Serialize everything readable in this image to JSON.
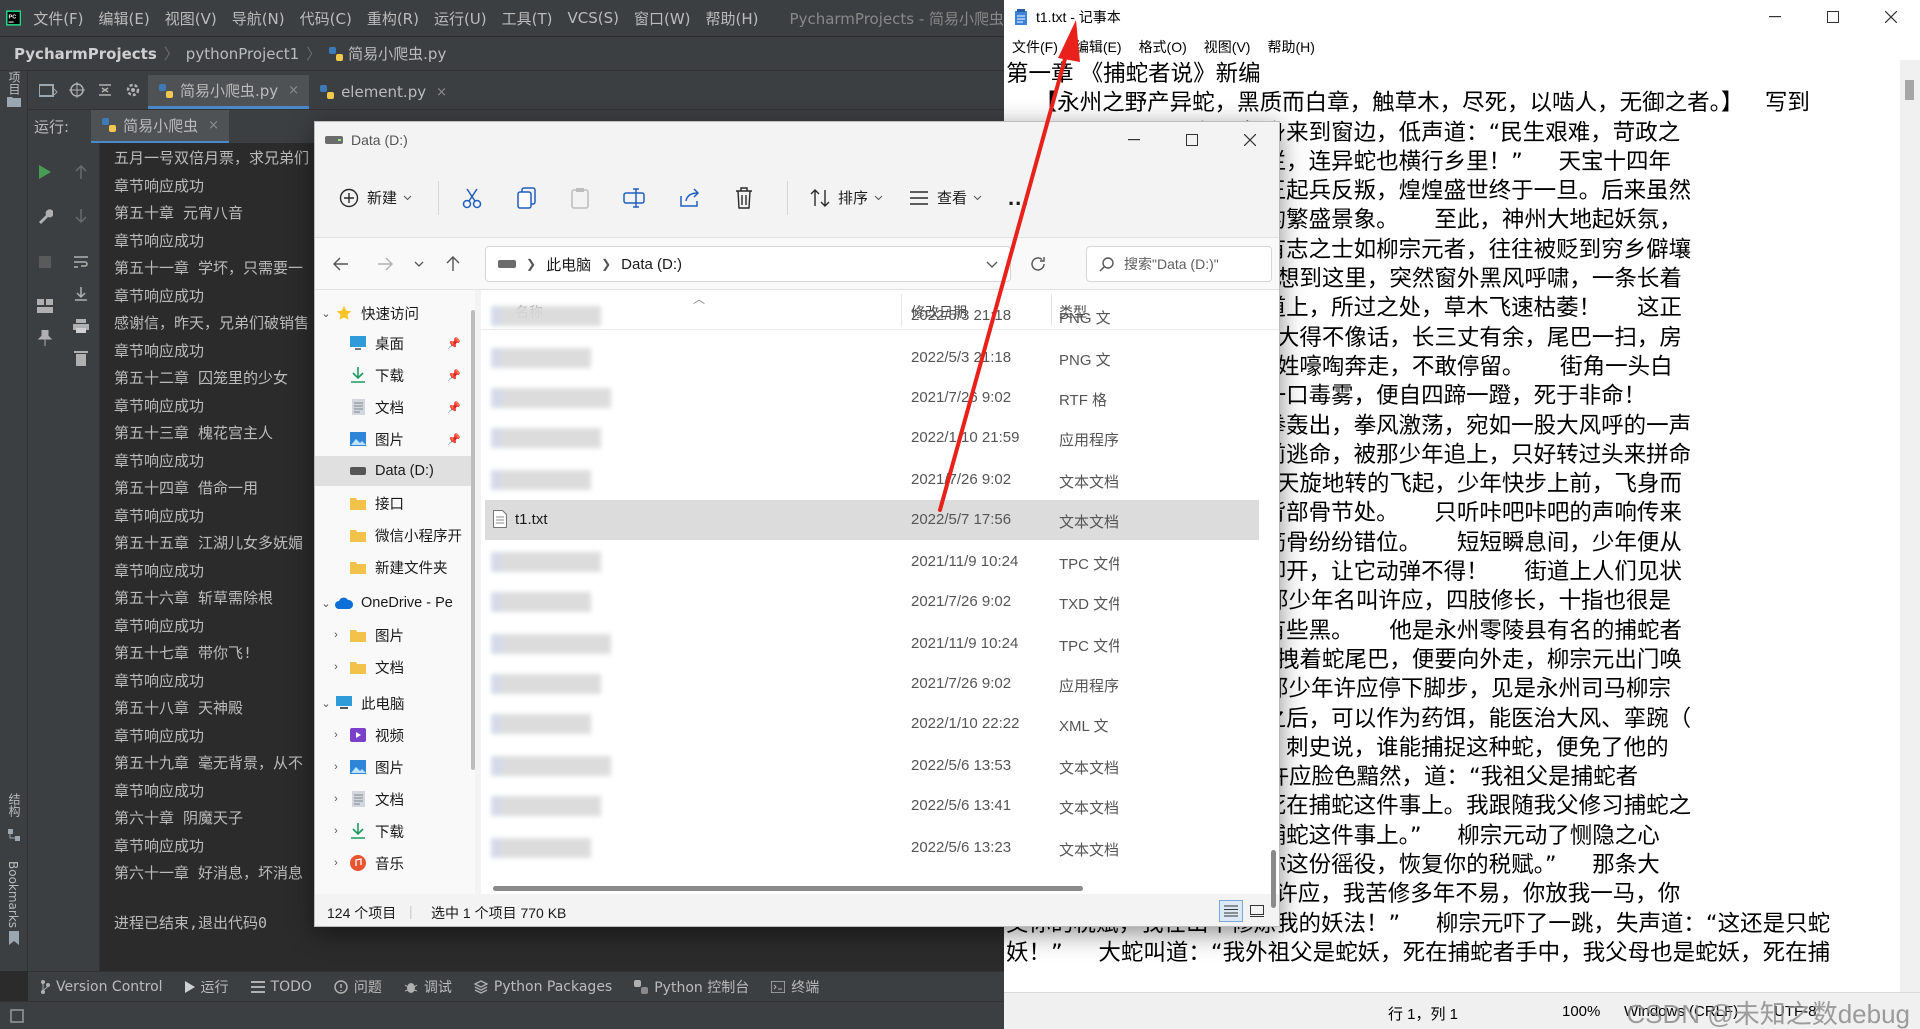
{
  "pycharm": {
    "menus": [
      "文件(F)",
      "编辑(E)",
      "视图(V)",
      "导航(N)",
      "代码(C)",
      "重构(R)",
      "运行(U)",
      "工具(T)",
      "VCS(S)",
      "窗口(W)",
      "帮助(H)"
    ],
    "title": "PycharmProjects - 简易小爬虫",
    "breadcrumb": [
      "PycharmProjects",
      "pythonProject1",
      "简易小爬虫.py"
    ],
    "left_labels": {
      "project": "项目",
      "structure": "结构",
      "bookmarks": "Bookmarks"
    },
    "editor_tabs": [
      {
        "label": "简易小爬虫.py",
        "close": "×"
      },
      {
        "label": "element.py",
        "close": "×"
      }
    ],
    "run_label": "运行:",
    "run_tab": "简易小爬虫",
    "run_tab_close": "×",
    "console_lines": [
      "五月一号双倍月票，求兄弟们",
      "章节响应成功",
      "第五十章 元宵八音",
      "章节响应成功",
      "第五十一章 学坏，只需要一",
      "章节响应成功",
      "感谢信，昨天，兄弟们破销售",
      "章节响应成功",
      "第五十二章 囚笼里的少女",
      "章节响应成功",
      "第五十三章 槐花宫主人",
      "章节响应成功",
      "第五十四章 借命一用",
      "章节响应成功",
      "第五十五章 江湖儿女多妩媚",
      "章节响应成功",
      "第五十六章 斩草需除根",
      "章节响应成功",
      "第五十七章 带你飞!",
      "章节响应成功",
      "第五十八章 天神殿",
      "章节响应成功",
      "第五十九章 毫无背景，从不",
      "章节响应成功",
      "第六十章 阴魔天子",
      "章节响应成功",
      "第六十一章 好消息，坏消息"
    ],
    "exit_line": "进程已结束,退出代码0",
    "bottom_tabs": [
      "Version Control",
      "运行",
      "TODO",
      "问题",
      "调试",
      "Python Packages",
      "Python 控制台",
      "终端"
    ]
  },
  "explorer": {
    "title": "Data (D:)",
    "toolbar": {
      "new": "新建",
      "sort": "排序",
      "view": "查看",
      "more": "..."
    },
    "address": [
      "此电脑",
      "Data (D:)"
    ],
    "search_placeholder": "搜索\"Data (D:)\"",
    "columns": {
      "name": "名称",
      "date": "修改日期",
      "type": "类型"
    },
    "nav": {
      "quick_access": "快速访问",
      "desktop": "桌面",
      "downloads": "下载",
      "documents": "文档",
      "pictures": "图片",
      "data": "Data (D:)",
      "interface": "接口",
      "wechat": "微信小程序开",
      "new_folder": "新建文件夹",
      "onedrive": "OneDrive - Pe",
      "od_pictures": "图片",
      "od_docs": "文档",
      "this_pc": "此电脑",
      "video": "视频",
      "pc_pictures": "图片",
      "pc_docs": "文档",
      "pc_downloads": "下载",
      "music": "音乐"
    },
    "files": [
      {
        "name": "",
        "date": "2022/5/3 21:18",
        "type": "PNG 文"
      },
      {
        "name": "",
        "date": "2022/5/3 21:18",
        "type": "PNG 文"
      },
      {
        "name": "",
        "date": "2021/7/26 9:02",
        "type": "RTF 格"
      },
      {
        "name": "",
        "date": "2022/1/10 21:59",
        "type": "应用程序"
      },
      {
        "name": "",
        "date": "2021/7/26 9:02",
        "type": "文本文档"
      },
      {
        "name": "t1.txt",
        "date": "2022/5/7 17:56",
        "type": "文本文档"
      },
      {
        "name": "",
        "date": "2021/11/9 10:24",
        "type": "TPC 文件"
      },
      {
        "name": "",
        "date": "2021/7/26 9:02",
        "type": "TXD 文件"
      },
      {
        "name": "",
        "date": "2021/11/9 10:24",
        "type": "TPC 文件"
      },
      {
        "name": "",
        "date": "2021/7/26 9:02",
        "type": "应用程序"
      },
      {
        "name": "",
        "date": "2022/1/10 22:22",
        "type": "XML 文"
      },
      {
        "name": "",
        "date": "2022/5/6 13:53",
        "type": "文本文档"
      },
      {
        "name": "",
        "date": "2022/5/6 13:41",
        "type": "文本文档"
      },
      {
        "name": "",
        "date": "2022/5/6 13:23",
        "type": "文本文档"
      }
    ],
    "status": {
      "count": "124 个项目",
      "selected": "选中 1 个项目  770 KB"
    }
  },
  "notepad": {
    "title": "t1.txt - 记事本",
    "menus": [
      "文件(F)",
      "编辑(E)",
      "格式(O)",
      "视图(V)",
      "帮助(H)"
    ],
    "lines": [
      "第一章 《捕蛇者说》新编",
      "    【永州之野产异蛇，黑质而白章，触草木，尽死，以啮人，无御之者。】   写到",
      "              ，叹了口气，起身来到窗边，低声道：“民生艰难，苛政之",
      "              年至今，国事糜烂，连异蛇也横行乡里！”     天宝十四年",
      "              昏庸了，东平郡王起兵反叛，煌煌盛世终于一旦。后来虽然",
      "              据，终不复当年的繁盛景象。     至此，神州大地起妖氛，",
      "              道，宦官弄权，有志之士如柳宗元者，往往被贬到穷乡僻壤",
      "              负。     柳宗元刚想到这里，突然窗外黑风呼啸，一条长着",
      "              从水沟里冲到街道上，所过之处，草木飞速枯萎！     这正",
      "              ！     只是这条蛇大得不像话，长三丈有余，尾巴一扫，房",
      "              漫。     街道上百姓嚎啕奔走，不敢停留。     街角一头白",
      "              不及躲避，吸了一口毒雾，便自四蹄一蹬，死于非命！",
      "              从后方冲来，一拳轰出，拳风激荡，宛如一股大风呼的一声",
      "              恐莫名，飞速向前逃命，被那少年追上，只好转过头来拼命",
      "              下巴上。     大蛇天旋地转的飞起，少年快步上前，飞身而",
      "              三点在那大蛇的背部骨节处。     只听咔吧咔吧的声响传来",
      "              所过之处，大蛇筋骨纷纷错位。     短短瞬息间，少年便从",
      "              蛇一身骨头全部卸开，让它动弹不得！     街道上人们见状",
      "              ！好身手！”     那少年名叫许应，四肢修长，十指也很是",
      "              吹日晒，皮肤稍有些黑。     他是永州零陵县有名的捕蛇者",
      "              好本事。     许应拽着蛇尾巴，便要向外走，柳宗元出门唤",
      "              抓蛇何为？”     那少年许应停下脚步，见是永州司马柳宗",
      "              司马，此蛇蜡干之后，可以作为药饵，能医治大风、挛踠（",
      "              去死肌，杀三虫。刺史说，谁能捕捉这种蛇，便免了他的",
      "              “那很好啊。”     许应脸色黯然，道：“我祖父是捕蛇者",
      "              也是捕蛇者，也死在捕蛇这件事上。我跟随我父修习捕蛇之",
      "              知何时也会死在捕蛇这件事上。”     柳宗元动了恻隐之心",
      "              可以让刺史免去你这份徭役，恢复你的税赋。”     那条大",
      "              “柳大人说得好！许应，我苦修多年不易，你放我一马，你",
      "交你的税赋，我在山中修炼我的妖法！”     柳宗元吓了一跳，失声道：“这还是只蛇",
      "妖！”     大蛇叫道：“我外祖父是蛇妖，死在捕蛇者手中，我父母也是蛇妖，死在捕"
    ],
    "status": {
      "position": "行 1，列 1",
      "zoom": "100%",
      "eol": "Windows (CRLF)",
      "encoding": "UTF-8"
    },
    "watermark": "CSDN @未知之数debug"
  },
  "colors": {
    "arrow": "#e8211b",
    "accent": "#4a88c7"
  }
}
